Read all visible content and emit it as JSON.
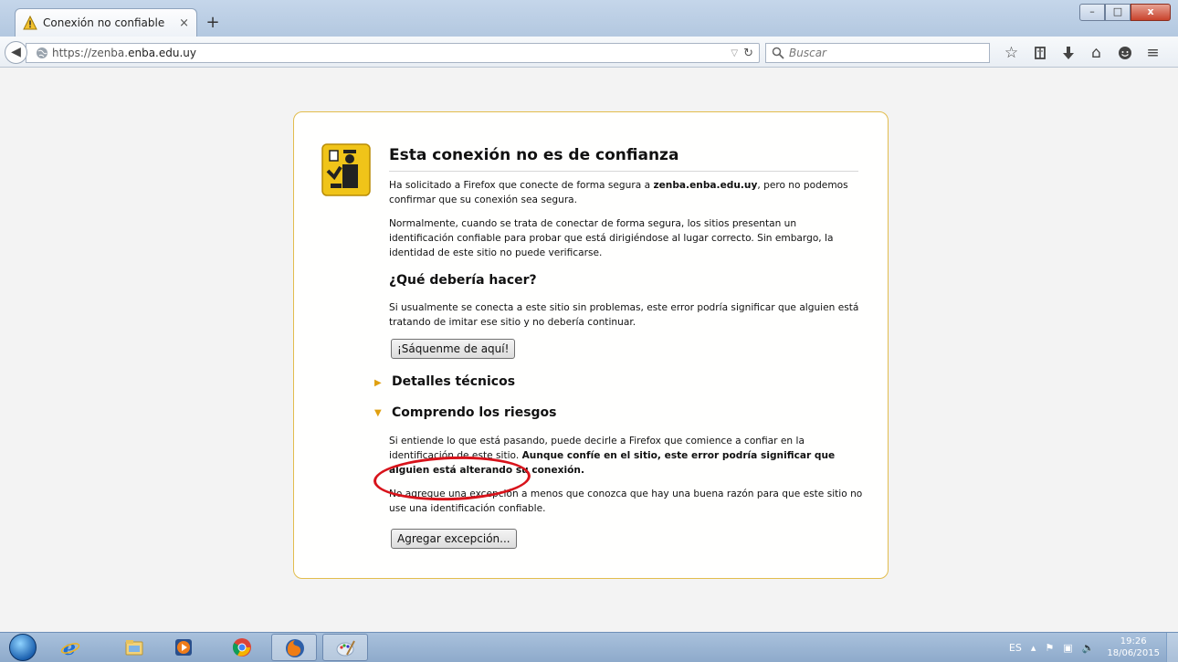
{
  "browser": {
    "tab": {
      "title": "Conexión no confiable",
      "close": "×"
    },
    "newtab": "+",
    "window_buttons": {
      "minimize": "–",
      "maximize": "□",
      "close": "x"
    },
    "url": {
      "prefix": "https://zenba.",
      "domain": "enba.edu.uy"
    },
    "search": {
      "placeholder": "Buscar"
    },
    "toolbar_icons": [
      "bookmark-star-icon",
      "reading-list-icon",
      "downloads-icon",
      "home-icon",
      "hello-icon",
      "menu-icon"
    ]
  },
  "error_page": {
    "title": "Esta conexión no es de confianza",
    "p1_before": "Ha solicitado a Firefox que conecte de forma segura a ",
    "p1_host": "zenba.enba.edu.uy",
    "p1_after": ", pero no podemos confirmar que su conexión sea segura.",
    "p2": "Normalmente, cuando se trata de conectar de forma segura, los sitios presentan un identificación confiable para probar que está dirigiéndose al lugar correcto. Sin embargo, la identidad de este sitio no puede verificarse.",
    "what_heading": "¿Qué debería hacer?",
    "p3": "Si usualmente se conecta a este sitio sin problemas, este error podría significar que alguien está tratando de imitar ese sitio y no debería continuar.",
    "get_me_out_button": "¡Sáquenme de aquí!",
    "technical_details": "Detalles técnicos",
    "understand_risks": "Comprendo los riesgos",
    "p4_before": "Si entiende lo que está pasando, puede decirle a Firefox que comience a confiar en la identificación de este sitio. ",
    "p4_bold": "Aunque confíe en el sitio, este error podría significar que alguien está alterando su conexión.",
    "p5": "No agregue una excepción a menos que conozca que hay una buena razón para que este sitio no use una identificación confiable.",
    "add_exception_button": "Agregar excepción..."
  },
  "taskbar": {
    "apps": [
      "internet-explorer-icon",
      "file-explorer-icon",
      "media-player-icon",
      "chrome-icon",
      "firefox-icon",
      "paint-icon"
    ],
    "language": "ES",
    "time": "19:26",
    "date": "18/06/2015"
  },
  "colors": {
    "box_border": "#e2bd4d",
    "highlight_circle": "#d8131b",
    "disclosure_arrow": "#e0a010"
  }
}
